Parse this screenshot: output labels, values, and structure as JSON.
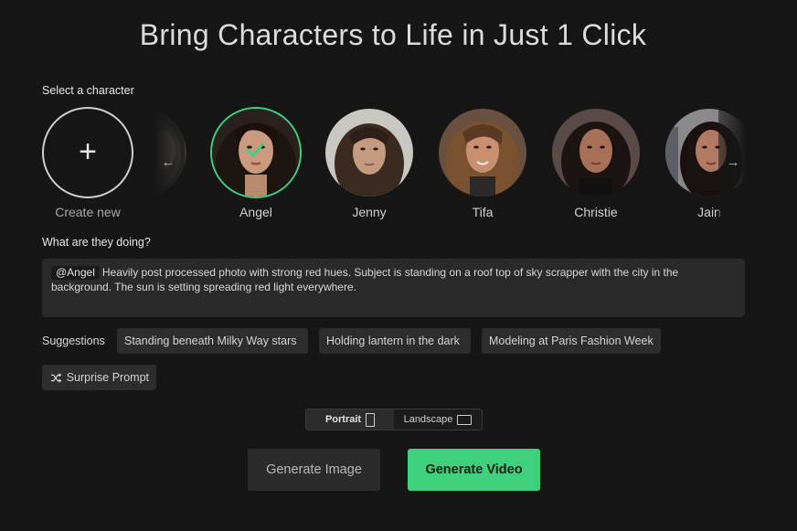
{
  "title": "Bring Characters to Life in Just 1 Click",
  "select_label": "Select a character",
  "create_new_label": "Create new",
  "characters": [
    {
      "name": "Angel",
      "selected": true
    },
    {
      "name": "Jenny",
      "selected": false
    },
    {
      "name": "Tifa",
      "selected": false
    },
    {
      "name": "Christie",
      "selected": false
    },
    {
      "name": "Jain",
      "selected": false
    }
  ],
  "doing_label": "What are they doing?",
  "prompt": {
    "mention": "@Angel",
    "text": "Heavily post processed photo with strong red hues. Subject is standing on a roof top of sky scrapper with the city in the background. The sun is setting spreading red light everywhere."
  },
  "suggestions_label": "Suggestions",
  "suggestions": [
    "Standing beneath Milky Way stars",
    "Holding lantern in the dark",
    "Modeling at Paris Fashion Week"
  ],
  "surprise_label": "Surprise Prompt",
  "orientation": {
    "portrait": "Portrait",
    "landscape": "Landscape",
    "selected": "Portrait"
  },
  "buttons": {
    "generate_image": "Generate Image",
    "generate_video": "Generate Video"
  },
  "colors": {
    "background": "#161616",
    "accent": "#3fd07e",
    "panel": "#2a2a2a"
  },
  "icons": {
    "create": "plus-icon",
    "selected": "check-icon",
    "prev": "arrow-left-icon",
    "next": "arrow-right-icon",
    "surprise": "shuffle-icon"
  }
}
